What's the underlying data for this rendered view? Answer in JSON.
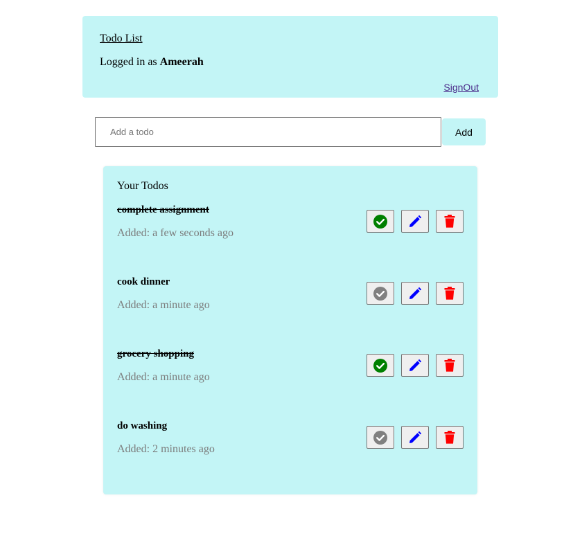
{
  "header": {
    "title": "Todo List",
    "logged_in_prefix": "Logged in as",
    "username": "Ameerah",
    "signout_label": "SignOut"
  },
  "add_form": {
    "placeholder": "Add a todo",
    "value": "",
    "button_label": "Add"
  },
  "todos_panel": {
    "title": "Your Todos",
    "items": [
      {
        "text": "complete assignment",
        "added": "Added: a few seconds ago",
        "completed": true
      },
      {
        "text": "cook dinner",
        "added": "Added: a minute ago",
        "completed": false
      },
      {
        "text": "grocery shopping",
        "added": "Added: a minute ago",
        "completed": true
      },
      {
        "text": "do washing",
        "added": "Added: 2 minutes ago",
        "completed": false
      }
    ]
  },
  "colors": {
    "panel_bg": "#c3f5f6",
    "complete_active": "#008000",
    "complete_inactive": "#808080",
    "edit": "#0000ff",
    "delete": "#ff0000"
  },
  "icons": {
    "complete": "check-circle-icon",
    "edit": "pencil-icon",
    "delete": "trash-icon"
  }
}
